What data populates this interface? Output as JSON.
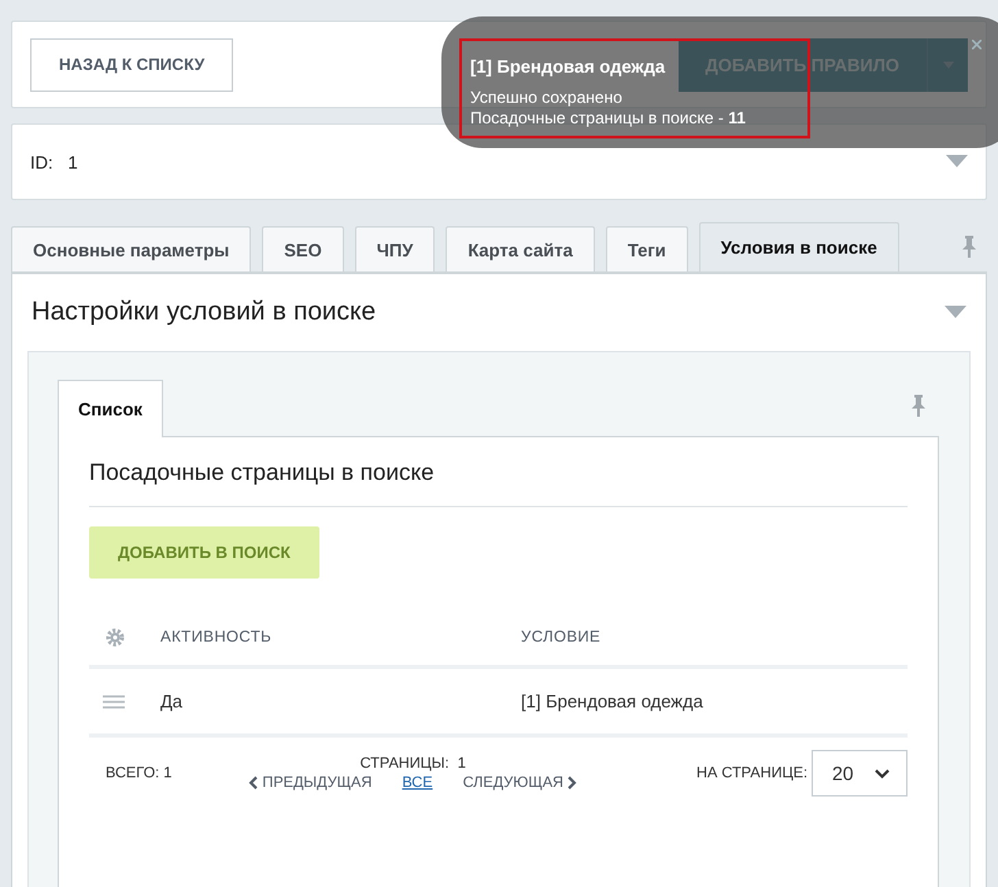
{
  "toolbar": {
    "back_button": "НАЗАД К СПИСКУ",
    "add_rule_button": "ДОБАВИТЬ ПРАВИЛО"
  },
  "notification": {
    "title": "[1] Брендовая одежда",
    "lines": [
      "Успешно сохранено",
      "Посадочные страницы в поиске - **11**"
    ],
    "highlighted": true
  },
  "id_field": {
    "label": "ID:",
    "value": "1"
  },
  "tabs": [
    {
      "label": "Основные параметры",
      "selected": false
    },
    {
      "label": "SEO",
      "selected": false
    },
    {
      "label": "ЧПУ",
      "selected": false
    },
    {
      "label": "Карта сайта",
      "selected": false
    },
    {
      "label": "Теги",
      "selected": false
    },
    {
      "label": "Условия в поиске",
      "selected": true
    }
  ],
  "section": {
    "title": "Настройки условий в поиске",
    "inner_tabs": [
      {
        "label": "Список",
        "selected": true
      }
    ],
    "list_title": "Посадочные страницы в поиске",
    "add_button": "ДОБАВИТЬ В ПОИСК",
    "table": {
      "columns": [
        "АКТИВНОСТЬ",
        "УСЛОВИЕ"
      ],
      "rows": [
        [
          "Да",
          "[1] Брендовая одежда"
        ]
      ]
    },
    "footer": {
      "total_label": "ВСЕГО:",
      "total": "1",
      "pages_label": "СТРАНИЦЫ:",
      "pages": "1",
      "prev": "ПРЕДЫДУЩАЯ",
      "all": "ВСЕ",
      "next": "СЛЕДУЮЩАЯ",
      "per_page_label": "НА СТРАНИЦЕ:",
      "per_page": "20"
    }
  }
}
